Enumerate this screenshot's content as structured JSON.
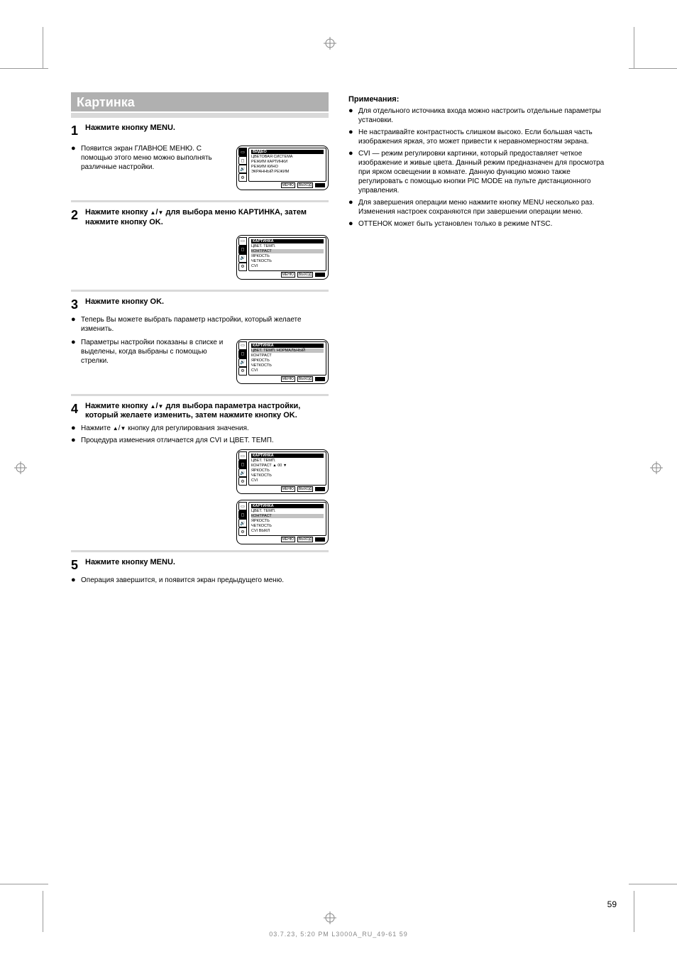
{
  "header": {
    "title": "Картинка"
  },
  "steps": [
    {
      "num": "1",
      "bold": "Нажмите кнопку MENU.",
      "bullet": "Появится экран ГЛАВНОЕ МЕНЮ. С помощью этого меню можно выполнять различные настройки."
    },
    {
      "num": "2",
      "prefix": "Нажмите кнопку",
      "mid": "для выбора меню КАРТИНКА, затем нажмите кнопку OK."
    },
    {
      "num": "3",
      "bold": "Нажмите кнопку OK.",
      "bullets": [
        "Теперь Вы можете выбрать параметр настройки, который желаете изменить.",
        "Параметры настройки показаны в списке и выделены, когда выбраны с помощью стрелки."
      ]
    },
    {
      "num": "4",
      "prefix": "Нажмите кнопку",
      "mid": "для выбора параметра настройки, который желаете изменить, затем нажмите кнопку OK.",
      "bullets": {
        "0a": "Нажмите",
        "0b": "кнопку для регулирования значения.",
        "1": "Процедура изменения отличается для CVI и ЦВЕТ. ТЕМП."
      }
    },
    {
      "num": "5",
      "bold": "Нажмите кнопку MENU.",
      "bullet": "Операция завершится, и появится экран предыдущего меню."
    }
  ],
  "osd": {
    "foot": {
      "menu": "МЕНЮ",
      "exit": "ВЫХОД"
    },
    "a": {
      "title": "ВИДЕО",
      "items": [
        "ЦВЕТОВАЯ СИСТЕМА",
        "РЕЖИМ КАРТИНКИ",
        "РЕЖИМ КИНО",
        "ЭКРАННЫЙ РЕЖИМ"
      ]
    },
    "b": {
      "title": "КАРТИНКА",
      "items": [
        "ЦВЕТ. ТЕМП.",
        "КОНТРАСТ",
        "ЯРКОСТЬ",
        "ЧЕТКОСТЬ",
        "CVI"
      ]
    },
    "c": {
      "title": "КАРТИНКА",
      "items": [
        "ЦВЕТ. ТЕМП.  НОРМАЛЬНЫЙ",
        "КОНТРАСТ",
        "ЯРКОСТЬ",
        "ЧЕТКОСТЬ",
        "CVI"
      ]
    },
    "d": {
      "title": "КАРТИНКА",
      "items": [
        "ЦВЕТ. ТЕМП.",
        "КОНТРАСТ  ▲ 00 ▼",
        "ЯРКОСТЬ",
        "ЧЕТКОСТЬ",
        "CVI"
      ]
    },
    "e": {
      "title": "КАРТИНКА",
      "items": [
        "ЦВЕТ. ТЕМП.",
        "КОНТРАСТ",
        "ЯРКОСТЬ",
        "ЧЕТКОСТЬ",
        "CVI  ВЫКЛ"
      ]
    }
  },
  "notes": {
    "heading": "Примечания:",
    "items": [
      "Для отдельного источника входа можно настроить отдельные параметры установки.",
      "Не настраивайте контрастность слишком высоко. Если большая часть изображения яркая, это может привести к неравномерностям экрана.",
      "CVI — режим регулировки картинки, который предоставляет четкое изображение и живые цвета. Данный режим предназначен для просмотра при ярком освещении в комнате. Данную функцию можно также регулировать с помощью кнопки PIC MODE на пульте дистанционного управления.",
      "Для завершения операции меню нажмите кнопку MENU несколько раз. Изменения настроек сохраняются при завершении операции меню.",
      "ОТТЕНОК может быть установлен только в режиме NTSC."
    ]
  },
  "footer": {
    "page": "59",
    "rev": "03.7.23, 5:20 PM     L3000A_RU_49-61     59"
  }
}
